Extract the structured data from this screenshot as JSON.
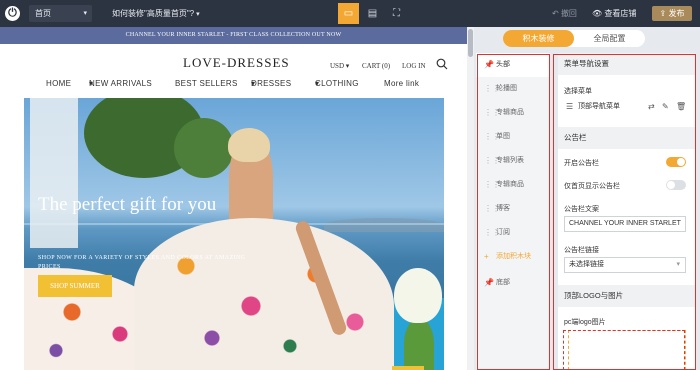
{
  "topbar": {
    "page_select": "首页",
    "help_link": "如何装修\"高质量首页\"?",
    "undo_label": "撤回",
    "view_store_label": "查看店铺",
    "publish_label": "发布"
  },
  "preview": {
    "announcement": "CHANNEL YOUR INNER STARLET - FIRST CLASS COLLECTION OUT NOW",
    "logo": "LOVE-DRESSES",
    "currency": "USD",
    "cart": "CART (0)",
    "login": "LOG IN",
    "nav": [
      "HOME",
      "NEW ARRIVALS",
      "BEST SELLERS",
      "DRESSES",
      "CLOTHING",
      "More link"
    ],
    "hero_title": "The perfect gift for you",
    "hero_subtitle": "SHOP NOW FOR A VARIETY OF STYLES AND COLORS AT AMAZING PRICES",
    "hero_button": "SHOP SUMMER"
  },
  "panel_tabs": {
    "blocks": "积木装修",
    "global": "全局配置"
  },
  "blocks": [
    "头部",
    "轮播图",
    "专辑商品",
    "单图",
    "专辑列表",
    "专辑商品",
    "博客",
    "订阅",
    "添加积木块",
    "底部"
  ],
  "settings": {
    "menu_section": "菜单导航设置",
    "select_menu_label": "选择菜单",
    "selected_menu": "顶部导航菜单",
    "announcement_section": "公告栏",
    "enable_announcement_label": "开启公告栏",
    "enable_announcement": true,
    "home_only_label": "仅首页显示公告栏",
    "home_only": false,
    "announcement_text_label": "公告栏文案",
    "announcement_text": "CHANNEL YOUR INNER STARLET",
    "announcement_link_label": "公告栏链接",
    "announcement_link": "未选择链接",
    "logo_section": "顶部LOGO与图片",
    "pc_logo_label": "pc端logo图片"
  },
  "accent_color": "#f3a833",
  "highlight_color": "#e03131"
}
